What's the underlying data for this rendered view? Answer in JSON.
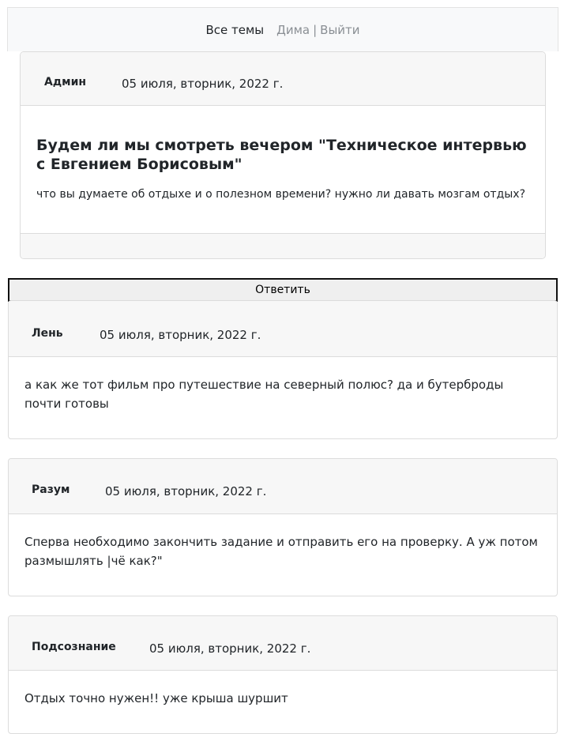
{
  "nav": {
    "all_topics": "Все темы",
    "user": "Дима",
    "separator": "|",
    "logout": "Выйти"
  },
  "topic": {
    "author": "Админ",
    "date": "05 июля, вторник, 2022 г.",
    "title": "Будем ли мы смотреть вечером \"Техническое интервью с Евгением Борисовым\"",
    "text": "что вы думаете об отдыхе и о полезном времени? нужно ли давать мозгам отдых?"
  },
  "reply_label": "Ответить",
  "comments": [
    {
      "author": "Лень",
      "date": "05 июля, вторник, 2022 г.",
      "text": "а как же тот фильм про путешествие на северный полюс? да и бутерброды почти готовы"
    },
    {
      "author": "Разум",
      "date": "05 июля, вторник, 2022 г.",
      "text": "Сперва необходимо закончить задание и отправить его на проверку. А уж потом размышлять |чё как?\""
    },
    {
      "author": "Подсознание",
      "date": "05 июля, вторник, 2022 г.",
      "text": "Отдых точно нужен!! уже крыша шуршит"
    }
  ]
}
